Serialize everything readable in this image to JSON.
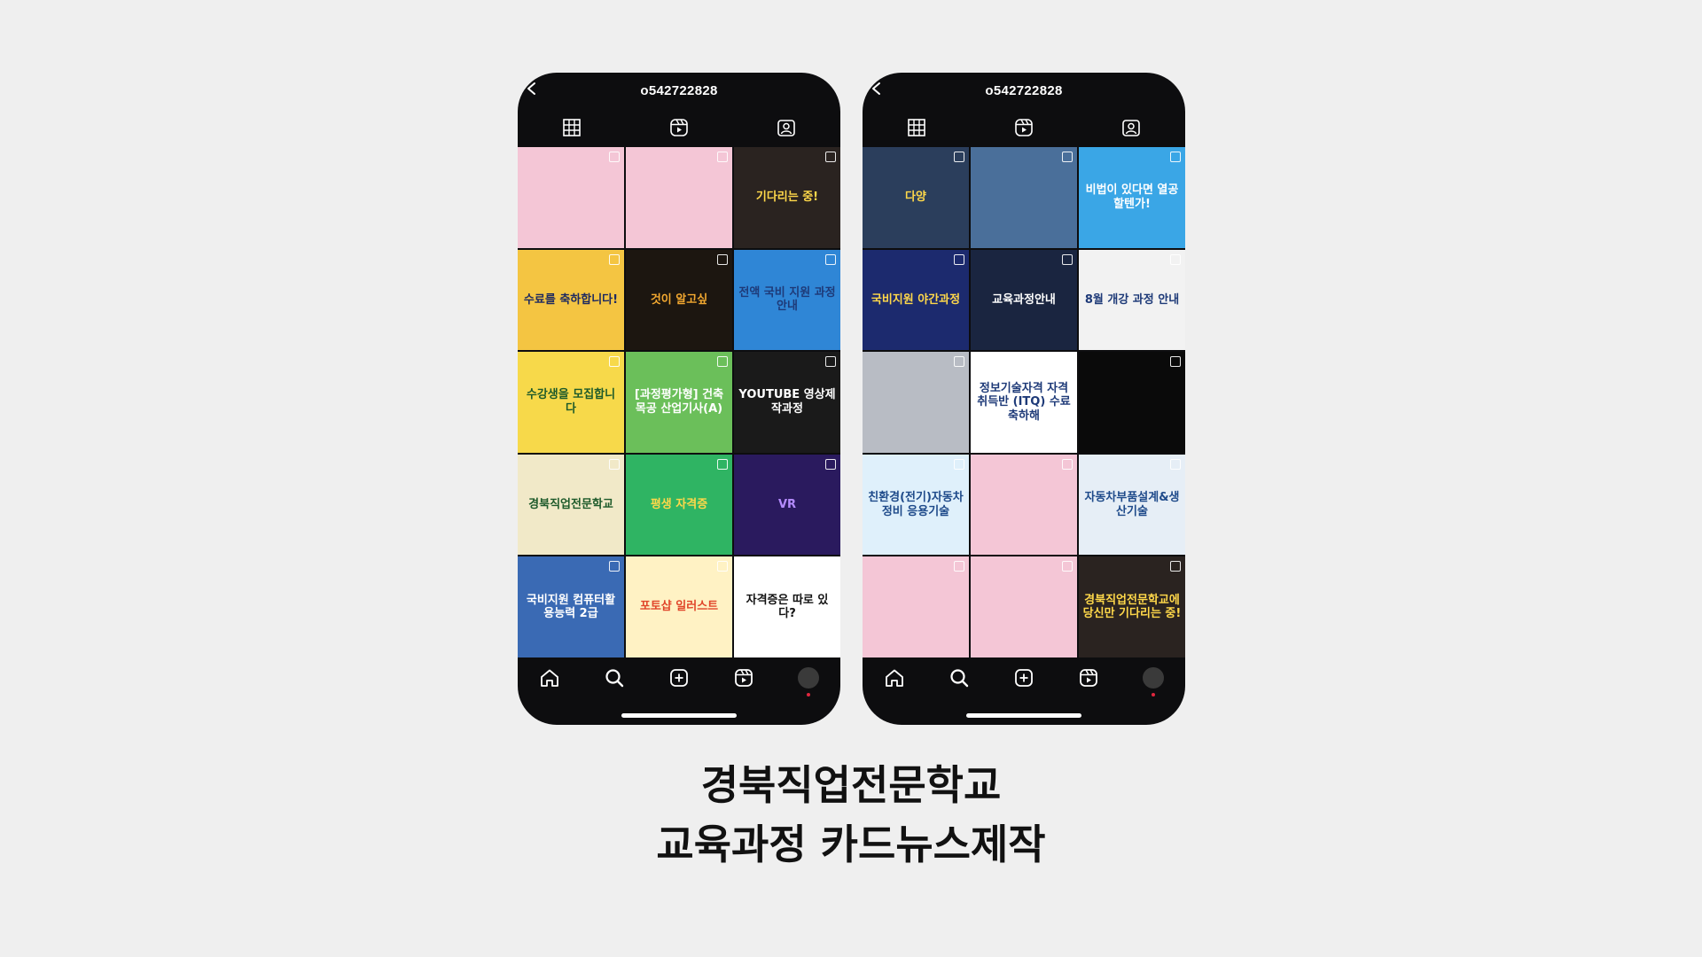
{
  "phones": [
    {
      "username": "o542722828",
      "tiles": [
        {
          "text": "",
          "bg": "#f4c6d6",
          "fg": "#222"
        },
        {
          "text": "",
          "bg": "#f4c6d6",
          "fg": "#222"
        },
        {
          "text": "기다리는 중!",
          "bg": "#2a2320",
          "fg": "#ffd84a"
        },
        {
          "text": "수료를 축하합니다!",
          "bg": "#f4c542",
          "fg": "#1e2a60"
        },
        {
          "text": "것이 알고싶",
          "bg": "#1c1610",
          "fg": "#f2a830"
        },
        {
          "text": "전액 국비 지원 과정 안내",
          "bg": "#2f86d6",
          "fg": "#1e3a78"
        },
        {
          "text": "수강생을 모집합니다",
          "bg": "#f7d94a",
          "fg": "#1d5a2a"
        },
        {
          "text": "[과정평가형] 건축목공 산업기사(A)",
          "bg": "#6bbf5a",
          "fg": "#ffffff"
        },
        {
          "text": "YOUTUBE 영상제작과정",
          "bg": "#1a1a1a",
          "fg": "#ffffff"
        },
        {
          "text": "경북직업전문학교",
          "bg": "#f1e9c8",
          "fg": "#1d5a2a"
        },
        {
          "text": "평생 자격증",
          "bg": "#2fb463",
          "fg": "#ffd84a"
        },
        {
          "text": "VR",
          "bg": "#2a1a5e",
          "fg": "#b58cff"
        },
        {
          "text": "국비지원 컴퓨터활용능력 2급",
          "bg": "#3a6ab4",
          "fg": "#ffffff"
        },
        {
          "text": "포토샵 일러스트",
          "bg": "#fff2c4",
          "fg": "#e0452a"
        },
        {
          "text": "자격증은 따로 있다?",
          "bg": "#ffffff",
          "fg": "#111111"
        }
      ]
    },
    {
      "username": "o542722828",
      "tiles": [
        {
          "text": "다양",
          "bg": "#2b3e5c",
          "fg": "#ffd84a"
        },
        {
          "text": "",
          "bg": "#4a6f9a",
          "fg": "#fff"
        },
        {
          "text": "비법이 있다면 열공할텐가!",
          "bg": "#3aa6e6",
          "fg": "#ffffff"
        },
        {
          "text": "국비지원 야간과정",
          "bg": "#1c2a6e",
          "fg": "#ffd84a"
        },
        {
          "text": "교육과정안내",
          "bg": "#1a2540",
          "fg": "#ffffff"
        },
        {
          "text": "8월 개강 과정 안내",
          "bg": "#f2f2f2",
          "fg": "#1e3a78"
        },
        {
          "text": "",
          "bg": "#b8bcc4",
          "fg": "#fff"
        },
        {
          "text": "정보기술자격 자격취득반 (ITQ) 수료축하해",
          "bg": "#ffffff",
          "fg": "#1e3a78"
        },
        {
          "text": "",
          "bg": "#0a0a0a",
          "fg": "#3ad14a"
        },
        {
          "text": "친환경(전기)자동차 정비 응용기술",
          "bg": "#dff0fb",
          "fg": "#1e4a8a"
        },
        {
          "text": "",
          "bg": "#f4c6d6",
          "fg": "#222"
        },
        {
          "text": "자동차부품설계&생산기술",
          "bg": "#e6eef6",
          "fg": "#1e4a8a"
        },
        {
          "text": "",
          "bg": "#f4c6d6",
          "fg": "#222"
        },
        {
          "text": "",
          "bg": "#f4c6d6",
          "fg": "#222"
        },
        {
          "text": "경북직업전문학교에 당신만 기다리는 중!",
          "bg": "#2a2320",
          "fg": "#ffd84a"
        }
      ]
    }
  ],
  "caption": {
    "line1": "경북직업전문학교",
    "line2": "교육과정 카드뉴스제작"
  },
  "icons": {
    "tabs": [
      "grid-icon",
      "reels-icon",
      "tagged-icon"
    ],
    "nav": [
      "home-icon",
      "search-icon",
      "add-icon",
      "reels-icon",
      "profile-icon"
    ]
  },
  "colors": {
    "phone_bg": "#0d0d0f",
    "page_bg": "#efefef",
    "notification": "#e0263e"
  }
}
